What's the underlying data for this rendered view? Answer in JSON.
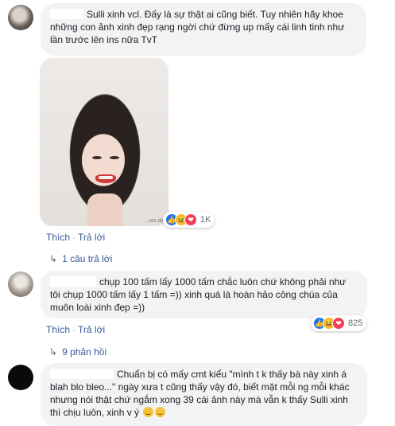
{
  "comments": [
    {
      "text": "Sulli xinh vcl. Đấy là sự thật ai cũng biết. Tuy nhiên hãy khoe những con ảnh xinh đẹp rạng ngời chứ đừng up mấy cái linh tinh như lần trước lên ins nữa TvT",
      "reaction_count": "1K",
      "reactions": [
        "like-icon",
        "haha-icon",
        "love-icon"
      ],
      "like_label": "Thích",
      "reply_label": "Trả lời",
      "replies_label": "1 câu trả lời",
      "photo_watermark": "...ws.dai"
    },
    {
      "text": "chụp 100 tấm lấy 1000 tấm chắc luôn chứ không phải như tôi chụp 1000 tấm lấy 1 tấm =)) xinh quá là hoàn hảo công chúa của muôn loài xinh đẹp =))",
      "reaction_count": "825",
      "reactions": [
        "like-icon",
        "haha-icon",
        "love-icon"
      ],
      "like_label": "Thích",
      "reply_label": "Trả lời",
      "replies_label": "9 phản hồi"
    },
    {
      "text": "Chuẩn bị có mấy cmt kiểu \"mình t k thấy bà này xinh á blah blo bleo...\" ngày xưa t cũng thấy vậy đó, biết mặt mỗi ng mỗi khác nhưng nói thật chứ ngắm xong 39 cái ảnh này mà vẫn k thấy Sulli xinh thì chịu luôn, xinh v ý"
    }
  ]
}
